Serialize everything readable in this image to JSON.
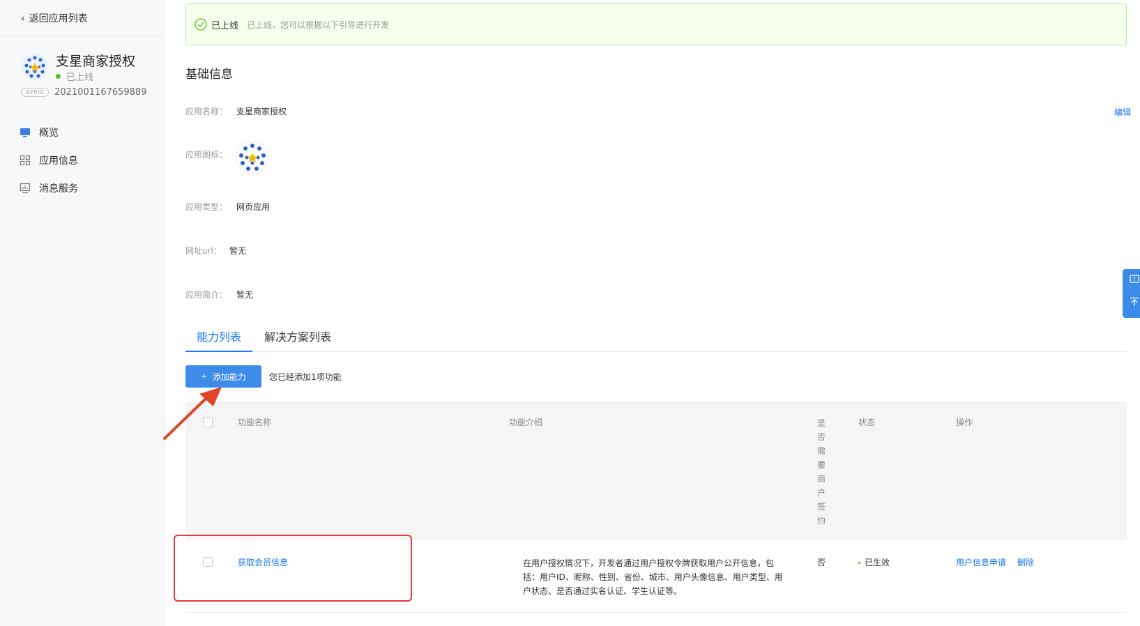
{
  "sidebar": {
    "back_label": "返回应用列表",
    "app_name": "支星商家授权",
    "app_status": "已上线",
    "appid_badge": "APPID",
    "appid": "2021001167659889",
    "nav": [
      {
        "label": "概览",
        "icon": "monitor-icon"
      },
      {
        "label": "应用信息",
        "icon": "grid-icon"
      },
      {
        "label": "消息服务",
        "icon": "chart-icon"
      }
    ]
  },
  "banner": {
    "title": "已上线",
    "desc": "已上线，您可以根据以下引导进行开发"
  },
  "basic": {
    "section_title": "基础信息",
    "name_label": "应用名称：",
    "name_value": "支星商家授权",
    "edit": "编辑",
    "icon_label": "应用图标：",
    "type_label": "应用类型：",
    "type_value": "网页应用",
    "url_label": "网址url：",
    "url_value": "暂无",
    "intro_label": "应用简介：",
    "intro_value": "暂无"
  },
  "tabs": [
    {
      "label": "能力列表",
      "active": true
    },
    {
      "label": "解决方案列表",
      "active": false
    }
  ],
  "toolbar": {
    "add_label": "添加能力",
    "hint": "您已经添加1项功能"
  },
  "table": {
    "headers": {
      "name": "功能名称",
      "intro": "功能介绍",
      "need_sign": "是否需要商户签约",
      "status": "状态",
      "action": "操作"
    },
    "rows": [
      {
        "name": "获取会员信息",
        "intro": "在用户授权情况下，开发者通过用户授权令牌获取用户公开信息，包括：用户ID、昵称、性别、省份、城市、用户头像信息、用户类型、用户状态、是否通过实名认证、学生认证等。",
        "need_sign": "否",
        "status": "已生效",
        "action_primary": "用户信息申请",
        "action_delete": "删除"
      }
    ]
  },
  "colors": {
    "accent": "#1677ff",
    "success": "#52c41a",
    "highlight": "#e53935"
  }
}
